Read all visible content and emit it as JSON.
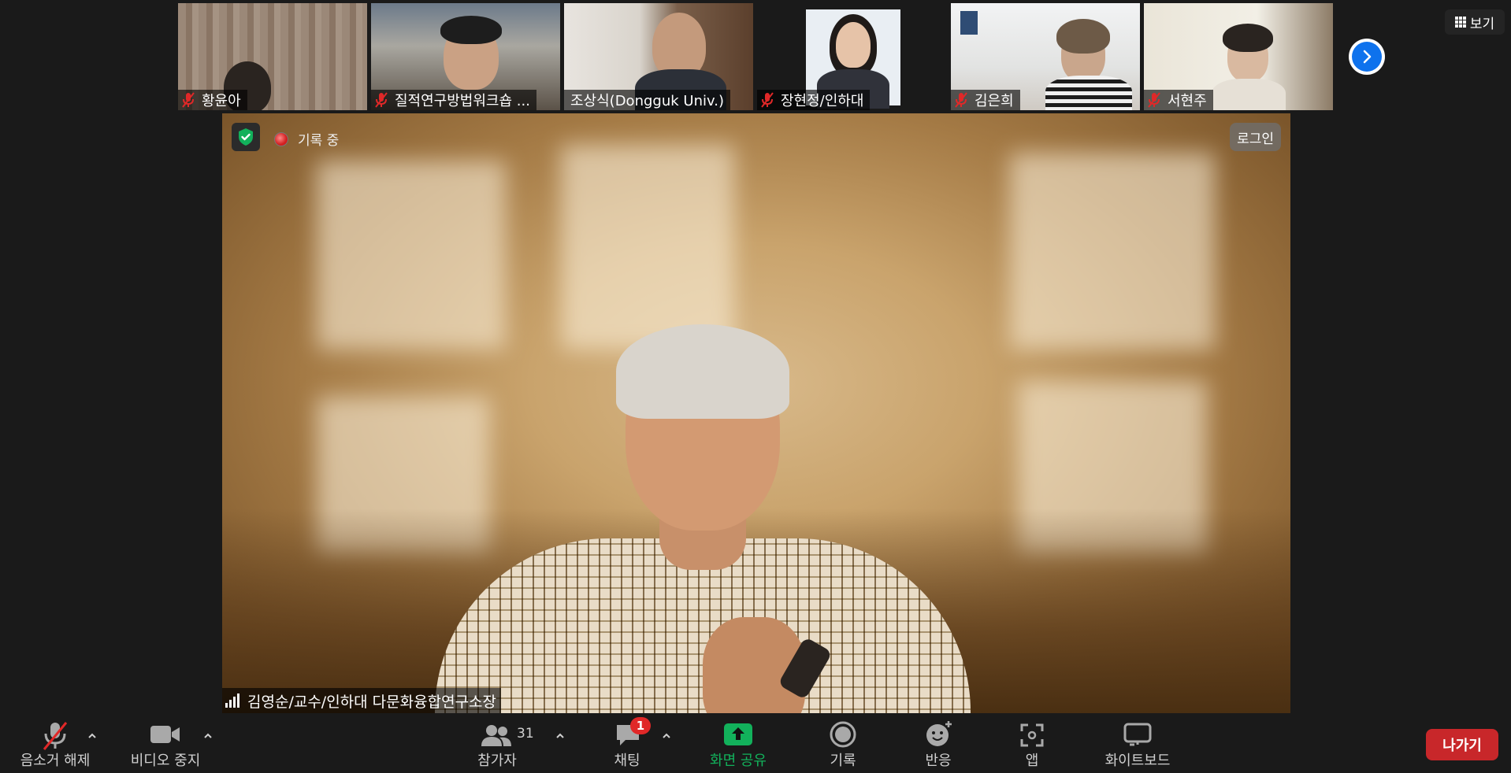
{
  "participants": [
    {
      "name": "황윤아",
      "muted": true
    },
    {
      "name": "질적연구방법워크숍 ...",
      "muted": true
    },
    {
      "name": "조상식(Dongguk Univ.)",
      "muted": false
    },
    {
      "name": "장현정/인하대",
      "muted": true
    },
    {
      "name": "김은희",
      "muted": true
    },
    {
      "name": "서현주",
      "muted": true
    }
  ],
  "view_button": {
    "label": "보기",
    "icon": "grid-icon"
  },
  "main_video": {
    "recording_label": "기록 중",
    "login_label": "로그인",
    "speaker_name": "김영순/교수/인하대 다문화융합연구소장"
  },
  "toolbar": {
    "unmute_label": "음소거 해제",
    "stop_video_label": "비디오 중지",
    "participants_label": "참가자",
    "participants_count": "31",
    "chat_label": "채팅",
    "chat_badge": "1",
    "share_label": "화면 공유",
    "record_label": "기록",
    "reactions_label": "반응",
    "apps_label": "앱",
    "whiteboard_label": "화이트보드",
    "leave_label": "나가기"
  },
  "colors": {
    "accent_blue": "#0e72ed",
    "share_green": "#12b15b",
    "leave_red": "#c8272a",
    "mute_red": "#e02828",
    "background": "#1a1a1a"
  }
}
